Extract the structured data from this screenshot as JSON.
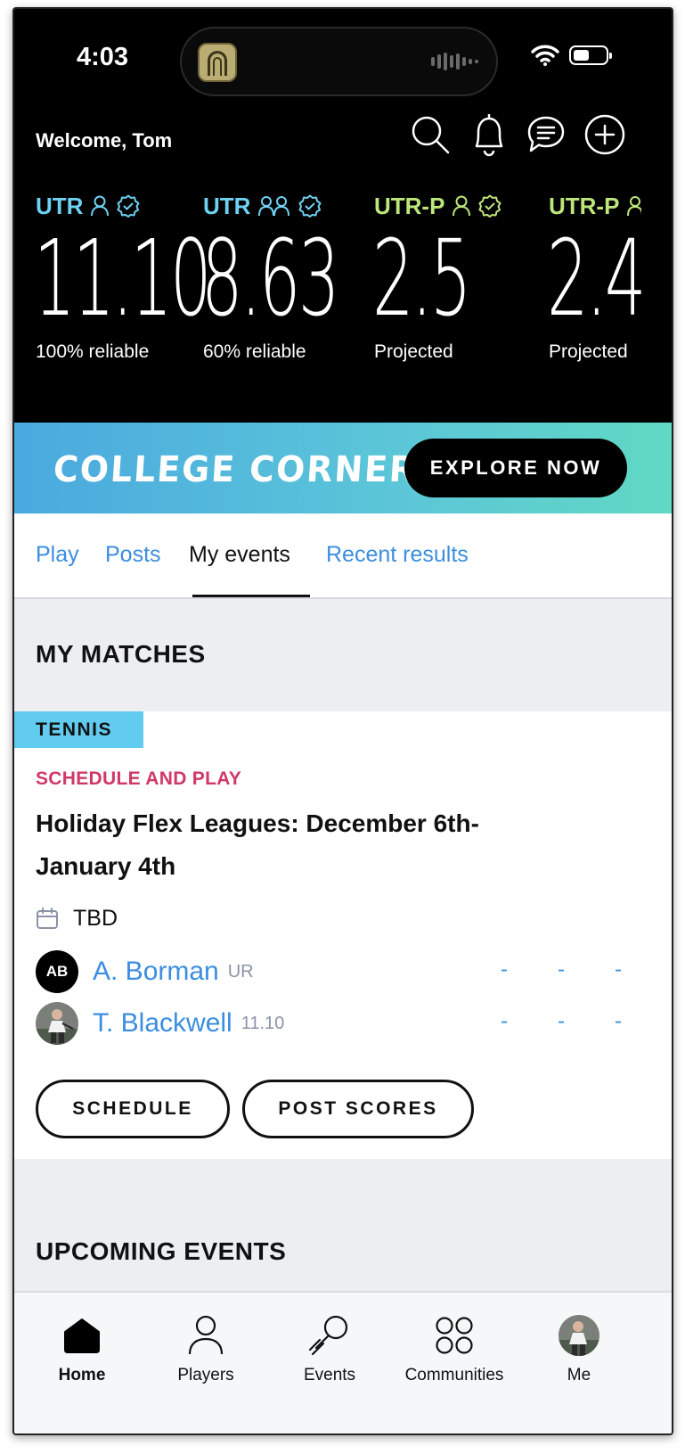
{
  "status_bar": {
    "time": "4:03"
  },
  "header": {
    "welcome": "Welcome, Tom",
    "icons": [
      "search-icon",
      "bell-icon",
      "chat-icon",
      "plus-circle-icon"
    ]
  },
  "ratings": [
    {
      "label": "UTR",
      "label_color": "#6fd1f2",
      "icon": "single-player-icon",
      "verified": true,
      "value": "11.10",
      "sub": "100% reliable"
    },
    {
      "label": "UTR",
      "label_color": "#6fd1f2",
      "icon": "doubles-players-icon",
      "verified": true,
      "value": "8.63",
      "sub": "60% reliable"
    },
    {
      "label": "UTR-P",
      "label_color": "#bde67a",
      "icon": "single-player-icon",
      "verified": true,
      "value": "2.5",
      "sub": "Projected"
    },
    {
      "label": "UTR-P",
      "label_color": "#bde67a",
      "icon": "doubles-players-icon",
      "verified": true,
      "value": "2.4",
      "sub": "Projected"
    }
  ],
  "banner": {
    "title": "COLLEGE CORNER",
    "button": "EXPLORE NOW"
  },
  "tabs": [
    {
      "label": "Play",
      "active": false
    },
    {
      "label": "Posts",
      "active": false
    },
    {
      "label": "My events",
      "active": true
    },
    {
      "label": "Recent results",
      "active": false
    }
  ],
  "my_matches": {
    "title": "MY MATCHES",
    "card": {
      "sport": "TENNIS",
      "event_type": "SCHEDULE AND PLAY",
      "event_name": "Holiday Flex Leagues: December 6th-January 4th",
      "date": "TBD",
      "players": [
        {
          "initials": "AB",
          "name": "A. Borman",
          "rating": "UR",
          "scores": [
            "-",
            "-",
            "-"
          ]
        },
        {
          "initials": "",
          "name": "T. Blackwell",
          "rating": "11.10",
          "scores": [
            "-",
            "-",
            "-"
          ]
        }
      ],
      "buttons": {
        "schedule": "SCHEDULE",
        "post_scores": "POST SCORES"
      }
    }
  },
  "upcoming_events": {
    "title": "UPCOMING EVENTS"
  },
  "bottom_nav": [
    {
      "label": "Home",
      "icon": "home-icon",
      "active": true
    },
    {
      "label": "Players",
      "icon": "person-icon",
      "active": false
    },
    {
      "label": "Events",
      "icon": "tennis-racket-icon",
      "active": false
    },
    {
      "label": "Communities",
      "icon": "communities-icon",
      "active": false
    },
    {
      "label": "Me",
      "icon": "avatar",
      "active": false
    }
  ],
  "colors": {
    "accent_blue": "#3b8ee0",
    "pink": "#d03866",
    "tag_blue": "#62cbf0"
  }
}
